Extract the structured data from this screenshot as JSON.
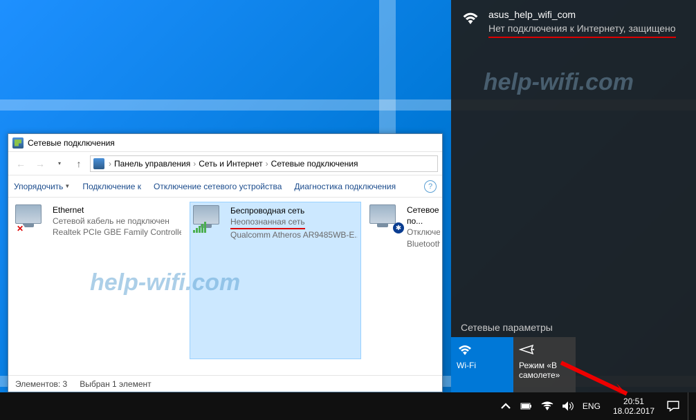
{
  "window": {
    "title": "Сетевые подключения",
    "breadcrumb": [
      "Панель управления",
      "Сеть и Интернет",
      "Сетевые подключения"
    ],
    "toolbar": {
      "organize": "Упорядочить",
      "connect_to": "Подключение к",
      "disable_device": "Отключение сетевого устройства",
      "diagnose": "Диагностика подключения"
    },
    "connections": [
      {
        "title": "Ethernet",
        "sub1": "Сетевой кабель не подключен",
        "sub2": "Realtek PCIe GBE Family Controller"
      },
      {
        "title": "Беспроводная сеть",
        "sub1": "Неопознанная сеть",
        "sub2": "Qualcomm Atheros AR9485WB-E..."
      },
      {
        "title": "Сетевое по...",
        "sub1": "Отключено",
        "sub2": "Bluetooth D..."
      }
    ],
    "status": {
      "elements": "Элементов: 3",
      "selected": "Выбран 1 элемент"
    }
  },
  "flyout": {
    "network_name": "asus_help_wifi_com",
    "network_status": "Нет подключения к Интернету, защищено",
    "settings_label": "Сетевые параметры",
    "tiles": {
      "wifi": "Wi-Fi",
      "airplane": "Режим «В самолете»"
    }
  },
  "taskbar": {
    "lang": "ENG",
    "time": "20:51",
    "date": "18.02.2017"
  },
  "watermark": "help-wifi.com"
}
